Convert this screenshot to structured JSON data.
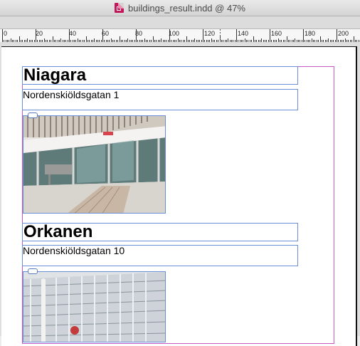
{
  "window": {
    "title": "buildings_result.indd @ 47%",
    "doc_icon": "indesign-document-icon"
  },
  "ruler": {
    "labels": [
      "0",
      "20",
      "40",
      "60",
      "80",
      "100",
      "120",
      "140",
      "160",
      "180",
      "200"
    ]
  },
  "items": [
    {
      "name": "Niagara",
      "address": "Nordenskiöldsgatan 1",
      "image": "niagara-building-photo"
    },
    {
      "name": "Orkanen",
      "address": "Nordenskiöldsgatan 10",
      "image": "orkanen-building-photo"
    }
  ],
  "colors": {
    "frame_edge": "#6a8fd6",
    "margin_guide": "#c858c8",
    "doc_icon": "#c2185b"
  }
}
